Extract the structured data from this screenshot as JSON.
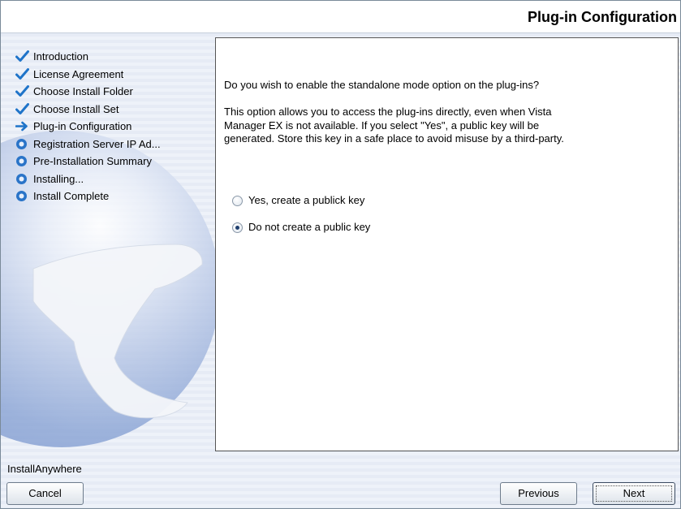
{
  "window": {
    "page_title": "Plug-in Configuration",
    "footer_brand": "InstallAnywhere"
  },
  "steps": [
    {
      "label": "Introduction",
      "state": "done",
      "icon": "checkmark-icon"
    },
    {
      "label": "License Agreement",
      "state": "done",
      "icon": "checkmark-icon"
    },
    {
      "label": "Choose Install Folder",
      "state": "done",
      "icon": "checkmark-icon"
    },
    {
      "label": "Choose Install Set",
      "state": "done",
      "icon": "checkmark-icon"
    },
    {
      "label": "Plug-in Configuration",
      "state": "current",
      "icon": "arrow-right-icon"
    },
    {
      "label": "Registration Server IP Ad...",
      "state": "pending",
      "icon": "pending-dot-icon"
    },
    {
      "label": "Pre-Installation Summary",
      "state": "pending",
      "icon": "pending-dot-icon"
    },
    {
      "label": "Installing...",
      "state": "pending",
      "icon": "pending-dot-icon"
    },
    {
      "label": "Install Complete",
      "state": "pending",
      "icon": "pending-dot-icon"
    }
  ],
  "content": {
    "question": "Do you wish to enable the standalone mode option on the plug-ins?",
    "description_lines": [
      "This option allows you to access the plug-ins directly, even when Vista",
      "Manager EX is not available. If you select \"Yes\", a public key will be",
      "generated. Store this key in a safe place to avoid misuse by a third-party."
    ],
    "options": [
      {
        "label": "Yes, create a publick key",
        "selected": false
      },
      {
        "label": "Do not create a public key",
        "selected": true
      }
    ]
  },
  "buttons": {
    "cancel": "Cancel",
    "previous": "Previous",
    "next": "Next"
  },
  "colors": {
    "check_blue": "#1f74c9",
    "pending_blue": "#2a74c8",
    "stripe_light": "#eef2f9",
    "stripe_dark": "#e6ebf5"
  }
}
